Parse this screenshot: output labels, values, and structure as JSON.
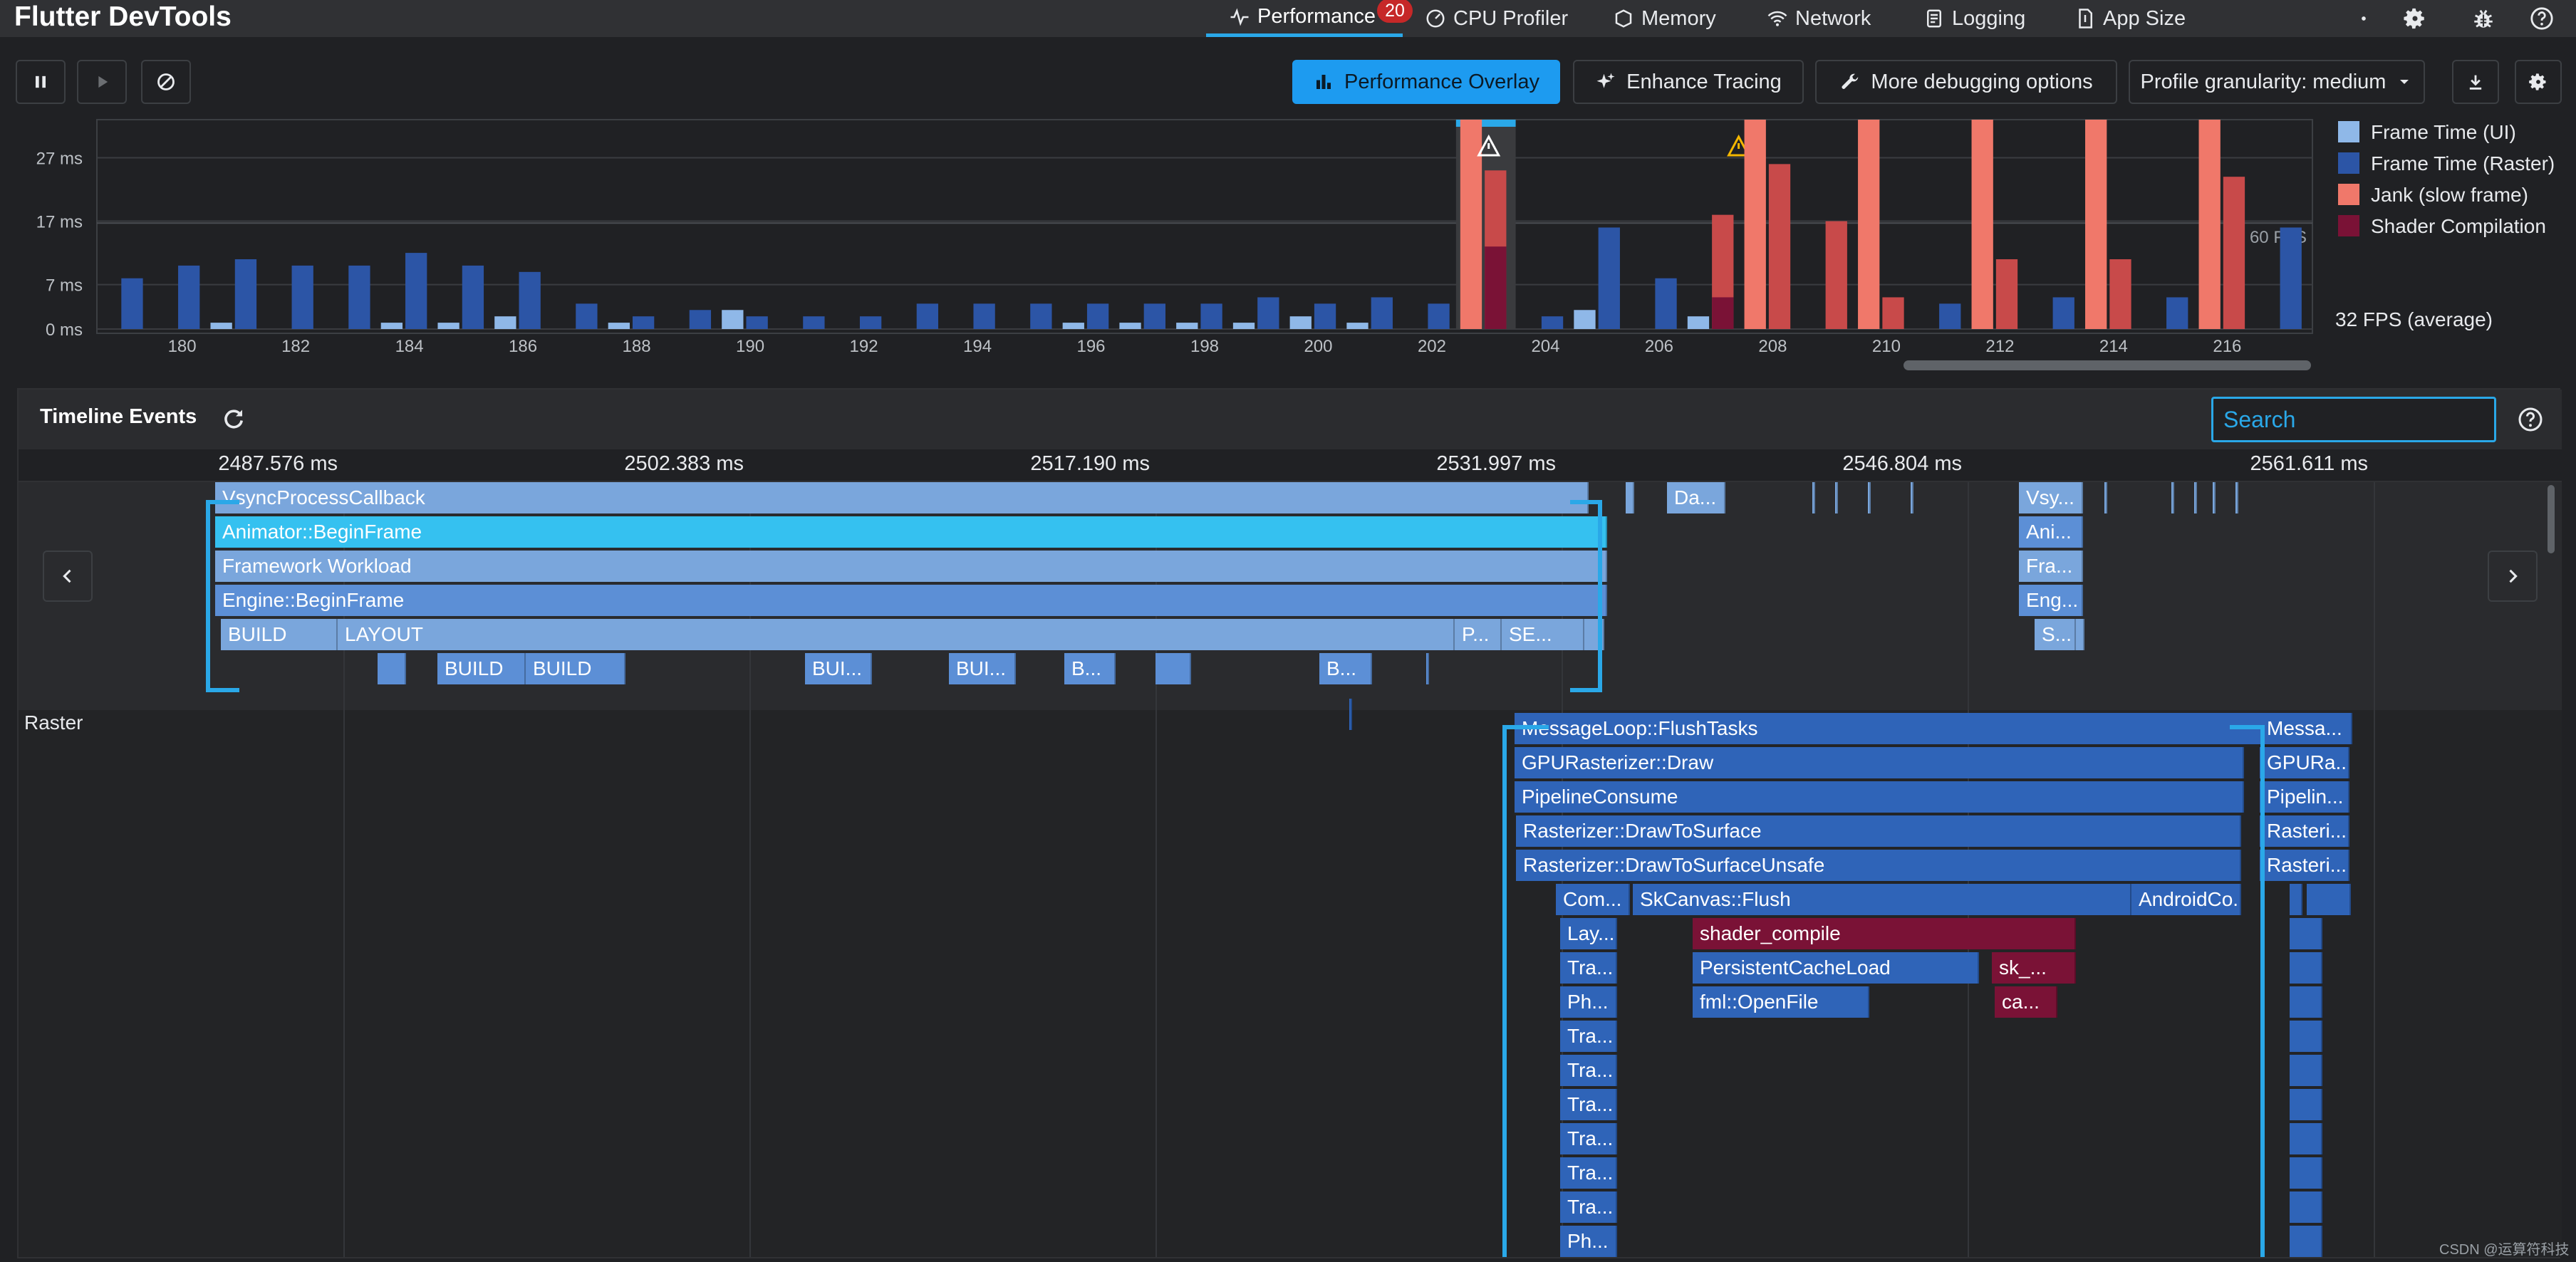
{
  "app": {
    "title": "Flutter DevTools"
  },
  "tabs": [
    {
      "label": "Performance",
      "icon": "performance-icon",
      "active": true,
      "badge": "20"
    },
    {
      "label": "CPU Profiler",
      "icon": "cpu-profiler-icon"
    },
    {
      "label": "Memory",
      "icon": "memory-icon"
    },
    {
      "label": "Network",
      "icon": "network-icon"
    },
    {
      "label": "Logging",
      "icon": "logging-icon"
    },
    {
      "label": "App Size",
      "icon": "app-size-icon"
    }
  ],
  "top_icons": [
    "dot-icon",
    "settings-icon",
    "bug-icon",
    "help-icon"
  ],
  "toolbar": {
    "pause_icon": "pause-icon",
    "resume_icon": "play-icon",
    "clear_icon": "clear-icon",
    "overlay_label": "Performance Overlay",
    "enhance_label": "Enhance Tracing",
    "debug_label": "More debugging options",
    "granularity_label": "Profile granularity: medium",
    "export_icon": "download-icon",
    "settings_icon": "settings-icon"
  },
  "chart_data": {
    "type": "bar",
    "y_ticks": [
      "27 ms",
      "17 ms",
      "7 ms",
      "0 ms"
    ],
    "target_label": "60 FPS",
    "average_label": "32 FPS (average)",
    "x_tick_labels": [
      "180",
      "182",
      "184",
      "186",
      "188",
      "190",
      "192",
      "194",
      "196",
      "198",
      "200",
      "202",
      "204",
      "206",
      "208",
      "210",
      "212",
      "214",
      "216"
    ],
    "ylim": [
      0,
      33
    ],
    "selected_frame": 203,
    "legend": [
      {
        "name": "Frame Time (UI)",
        "color": "#8fb8e8"
      },
      {
        "name": "Frame Time (Raster)",
        "color": "#2c55a6"
      },
      {
        "name": "Jank (slow frame)",
        "color": "#f0786a"
      },
      {
        "name": "Shader Compilation",
        "color": "#7a1236"
      }
    ],
    "frames": [
      {
        "frame": 179,
        "ui": 0,
        "raster": 8
      },
      {
        "frame": 180,
        "ui": 0,
        "raster": 10
      },
      {
        "frame": 181,
        "ui": 1,
        "raster": 11
      },
      {
        "frame": 182,
        "ui": 0,
        "raster": 10
      },
      {
        "frame": 183,
        "ui": 0,
        "raster": 10
      },
      {
        "frame": 184,
        "ui": 1,
        "raster": 12
      },
      {
        "frame": 185,
        "ui": 1,
        "raster": 10
      },
      {
        "frame": 186,
        "ui": 2,
        "raster": 9
      },
      {
        "frame": 187,
        "ui": 0,
        "raster": 4
      },
      {
        "frame": 188,
        "ui": 1,
        "raster": 2
      },
      {
        "frame": 189,
        "ui": 0,
        "raster": 3
      },
      {
        "frame": 190,
        "ui": 3,
        "raster": 2
      },
      {
        "frame": 191,
        "ui": 0,
        "raster": 2
      },
      {
        "frame": 192,
        "ui": 0,
        "raster": 2
      },
      {
        "frame": 193,
        "ui": 0,
        "raster": 4
      },
      {
        "frame": 194,
        "ui": 0,
        "raster": 4
      },
      {
        "frame": 195,
        "ui": 0,
        "raster": 4
      },
      {
        "frame": 196,
        "ui": 1,
        "raster": 4
      },
      {
        "frame": 197,
        "ui": 1,
        "raster": 4
      },
      {
        "frame": 198,
        "ui": 1,
        "raster": 4
      },
      {
        "frame": 199,
        "ui": 1,
        "raster": 5
      },
      {
        "frame": 200,
        "ui": 2,
        "raster": 4
      },
      {
        "frame": 201,
        "ui": 1,
        "raster": 5
      },
      {
        "frame": 202,
        "ui": 0,
        "raster": 4
      },
      {
        "frame": 203,
        "ui": 33,
        "raster": 25,
        "jank": true,
        "shader": 13,
        "warning": true
      },
      {
        "frame": 204,
        "ui": 0,
        "raster": 2
      },
      {
        "frame": 205,
        "ui": 3,
        "raster": 16
      },
      {
        "frame": 206,
        "ui": 0,
        "raster": 8
      },
      {
        "frame": 207,
        "ui": 2,
        "raster": 18,
        "jank": true,
        "shader": 5,
        "warning": true
      },
      {
        "frame": 208,
        "ui": 33,
        "raster": 26,
        "jank": true
      },
      {
        "frame": 209,
        "ui": 0,
        "raster": 17,
        "jank": true
      },
      {
        "frame": 210,
        "ui": 33,
        "raster": 5,
        "jank": true
      },
      {
        "frame": 211,
        "ui": 0,
        "raster": 4
      },
      {
        "frame": 212,
        "ui": 33,
        "raster": 11,
        "jank": true
      },
      {
        "frame": 213,
        "ui": 0,
        "raster": 5
      },
      {
        "frame": 214,
        "ui": 33,
        "raster": 11,
        "jank": true
      },
      {
        "frame": 215,
        "ui": 0,
        "raster": 5
      },
      {
        "frame": 216,
        "ui": 33,
        "raster": 24,
        "jank": true
      },
      {
        "frame": 217,
        "ui": 0,
        "raster": 16
      }
    ]
  },
  "timeline": {
    "title": "Timeline Events",
    "refresh_icon": "refresh-icon",
    "search_placeholder": "Search",
    "help_icon": "help-icon",
    "ticks": [
      "2487.576 ms",
      "2502.383 ms",
      "2517.190 ms",
      "2531.997 ms",
      "2546.804 ms",
      "2561.611 ms"
    ],
    "lane_raster": "Raster",
    "ui_events": [
      "VsyncProcessCallback",
      "Animator::BeginFrame",
      "Framework Workload",
      "Engine::BeginFrame",
      "BUILD",
      "LAYOUT",
      "P...",
      "SE...",
      "BUILD",
      "BUILD",
      "BUI...",
      "BUI...",
      "B...",
      "B...",
      "Da...",
      "Vsy...",
      "Ani...",
      "Fra...",
      "Eng...",
      "S..."
    ],
    "raster_events": [
      "MessageLoop::FlushTasks",
      "GPURasterizer::Draw",
      "PipelineConsume",
      "Rasterizer::DrawToSurface",
      "Rasterizer::DrawToSurfaceUnsafe",
      "Com...",
      "SkCanvas::Flush",
      "AndroidCo...",
      "Lay...",
      "Tra...",
      "Ph...",
      "shader_compile",
      "PersistentCacheLoad",
      "sk_...",
      "fml::OpenFile",
      "ca...",
      "Messa...",
      "GPURa...",
      "Pipelin...",
      "Rasteri...",
      "Rasteri...",
      "Ph..."
    ],
    "nav_prev_icon": "chevron-left-icon",
    "nav_next_icon": "chevron-right-icon"
  },
  "footer": {
    "credit": "CSDN @运算符科技"
  }
}
